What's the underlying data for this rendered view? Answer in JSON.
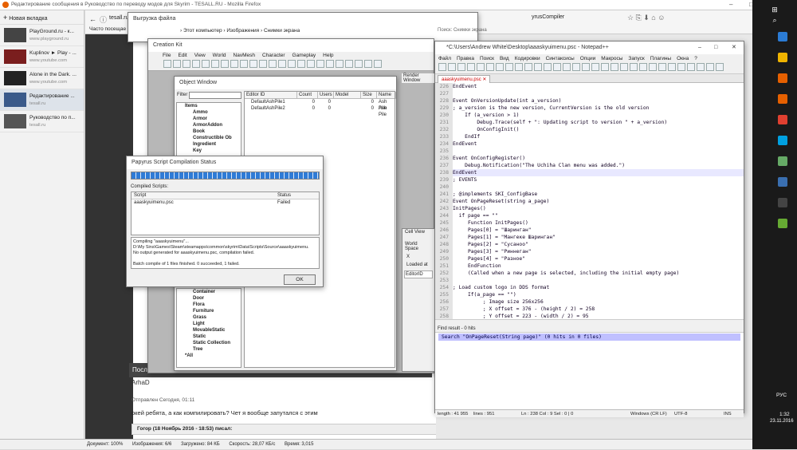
{
  "firefox": {
    "title": "Редактирование сообщения в Руководство по переводу модов для Skyrim - TESALL.RU - Mozilla Firefox",
    "new_tab": "Новая вкладка",
    "url": "tesall.ru",
    "tab_label": "Выгрузка файла",
    "tab2_label": "yrusCompiler",
    "bookmark": "Часто посещае"
  },
  "sidebar": {
    "items": [
      {
        "title": "PlayGround.ru - к...",
        "sub": "www.playground.ru"
      },
      {
        "title": "Kuplinov ► Play - ...",
        "sub": "www.youtube.com"
      },
      {
        "title": "Alone in the Dark. ...",
        "sub": "www.youtube.com"
      },
      {
        "title": "Редактирование ...",
        "sub": "tesall.ru"
      },
      {
        "title": "Руководство по п...",
        "sub": "tesall.ru"
      }
    ]
  },
  "explorer": {
    "breadcrumb": "› Этот компьютер › Изображения › Снимки экрана",
    "search": "Поиск: Снимки экрана"
  },
  "ck": {
    "title": "Creation Kit",
    "menu": [
      "File",
      "Edit",
      "View",
      "World",
      "NavMesh",
      "Character",
      "Gameplay",
      "Help"
    ],
    "object_window": {
      "title": "Object Window",
      "filter_label": "Filter",
      "tree_top": [
        "Items",
        "Ammo",
        "Armor",
        "ArmorAddon",
        "Book",
        "Constructible Ob",
        "Ingredient",
        "Key"
      ],
      "tree_bottom": [
        "Container",
        "Door",
        "Flora",
        "Furniture",
        "Grass",
        "Light",
        "MovableStatic",
        "Static",
        "Static Collection",
        "Tree",
        "*All"
      ],
      "columns": [
        "Editor ID",
        "Count",
        "Users",
        "Model",
        "Size",
        "Name"
      ],
      "rows": [
        {
          "id": "DefaultAshPile1",
          "count": "0",
          "users": "0",
          "size": "0",
          "name": "Ash Pile"
        },
        {
          "id": "DefaultAshPile2",
          "count": "0",
          "users": "0",
          "size": "0",
          "name": "Ash Pile"
        }
      ]
    },
    "render_window": "Render Window",
    "cell_view": {
      "title": "Cell View",
      "world_space": "World Space",
      "x": "X",
      "y": "Y",
      "loaded": "Loaded at",
      "editor_id": "EditorID"
    }
  },
  "papyrus": {
    "title": "Papyrus Script Compilation Status",
    "compiled_label": "Compiled Scripts:",
    "col_script": "Script",
    "col_status": "Status",
    "script": "aaaskyuimenu.psc",
    "status": "Failed",
    "log": [
      "Compiling \"aaaskyuimenu\"...",
      "D:\\My Sins\\Games\\Steam\\steamapps\\common\\skyrim\\Data\\Scripts\\Source\\aaaskyuimenu.",
      "No output generated for aaaskyuimenu.psc, compilation failed.",
      "",
      "Batch compile of 1 files finished. 0 succeeded, 1 failed."
    ],
    "ok": "OK"
  },
  "npp": {
    "title": "*C:\\Users\\Andrew White\\Desktop\\aaaskyuimenu.psc - Notepad++",
    "menu": [
      "Файл",
      "Правка",
      "Поиск",
      "Вид",
      "Кодировки",
      "Синтаксисы",
      "Опции",
      "Макросы",
      "Запуск",
      "Плагины",
      "Окна",
      "?"
    ],
    "tab": "aaaskyuimenu.psc",
    "lines": [
      {
        "n": "226",
        "t": "EndEvent"
      },
      {
        "n": "227",
        "t": ""
      },
      {
        "n": "228",
        "t": "Event OnVersionUpdate(int a_version)"
      },
      {
        "n": "229",
        "t": "; a_version is the new version, CurrentVersion is the old version"
      },
      {
        "n": "230",
        "t": "    If (a_version > 1)"
      },
      {
        "n": "231",
        "t": "        Debug.Trace(self + \": Updating script to version \" + a_version)"
      },
      {
        "n": "232",
        "t": "        OnConfigInit()"
      },
      {
        "n": "233",
        "t": "    EndIf"
      },
      {
        "n": "234",
        "t": "EndEvent"
      },
      {
        "n": "235",
        "t": ""
      },
      {
        "n": "236",
        "t": "Event OnConfigRegister()"
      },
      {
        "n": "237",
        "t": "    Debug.Notification(\"The Uchiha Clan menu was added.\")"
      },
      {
        "n": "238",
        "t": "EndEvent"
      },
      {
        "n": "239",
        "t": "; EVENTS"
      },
      {
        "n": "240",
        "t": ""
      },
      {
        "n": "241",
        "t": "; @implements SKI_ConfigBase"
      },
      {
        "n": "242",
        "t": "Event OnPageReset(string a_page)"
      },
      {
        "n": "243",
        "t": "InitPages()"
      },
      {
        "n": "244",
        "t": "  if page == \"\""
      },
      {
        "n": "245",
        "t": "     Function InitPages()"
      },
      {
        "n": "246",
        "t": "     Pages[0] = \"Шаринган\""
      },
      {
        "n": "247",
        "t": "     Pages[1] = \"Мангеке Шаринган\""
      },
      {
        "n": "248",
        "t": "     Pages[2] = \"Сусаноо\""
      },
      {
        "n": "249",
        "t": "     Pages[3] = \"Риннеган\""
      },
      {
        "n": "250",
        "t": "     Pages[4] = \"Разное\""
      },
      {
        "n": "251",
        "t": "     EndFunction"
      },
      {
        "n": "252",
        "t": "     (Called when a new page is selected, including the initial empty page)"
      },
      {
        "n": "253",
        "t": ""
      },
      {
        "n": "254",
        "t": "; Load custom logo in DDS format"
      },
      {
        "n": "255",
        "t": "     If(a_page == \"\")"
      },
      {
        "n": "256",
        "t": "          ; Image size 256x256"
      },
      {
        "n": "257",
        "t": "          ; X offset = 376 - (height / 2) = 258"
      },
      {
        "n": "258",
        "t": "          ; Y offset = 223 - (width / 2) = 95"
      },
      {
        "n": "259",
        "t": "          ;LoadCustomContent(\"the uchiha clan/the uchiha clan logo.dds\", 0, 0)"
      }
    ],
    "find_title": "Find result - 0 hits",
    "find_text": "Search \"OnPageReset(String page)\" (0 hits in 0 files)",
    "status": {
      "length": "length : 41 955",
      "lines": "lines : 951",
      "pos": "Ln : 238   Col : 9   Sel : 0 | 0",
      "eol": "Windows (CR LF)",
      "enc": "UTF-8",
      "ins": "INS"
    }
  },
  "forum": {
    "post_header": "Посл",
    "user": "ArhaD",
    "sent": "Отправлен Сегодня, 01:11",
    "message": "окей ребята, а как компилировать? Чет я вообще запутался с этим",
    "quote": "Гогор (18 Ноябрь 2016 - 18:53) писал:"
  },
  "ff_status": {
    "doc": "Документ: 100%",
    "images": "Изображения: 6/6",
    "loaded": "Загружено: 84 КБ",
    "speed": "Скорость: 28,07 КБ/с",
    "time": "Время: 3,015"
  },
  "taskbar": {
    "lang": "РУС",
    "time": "1:32",
    "date": "23.11.2016"
  },
  "colors": {
    "taskbar": "#1a1a1a",
    "selection": "#c0c0ff",
    "progress": "#2f7bd6"
  }
}
